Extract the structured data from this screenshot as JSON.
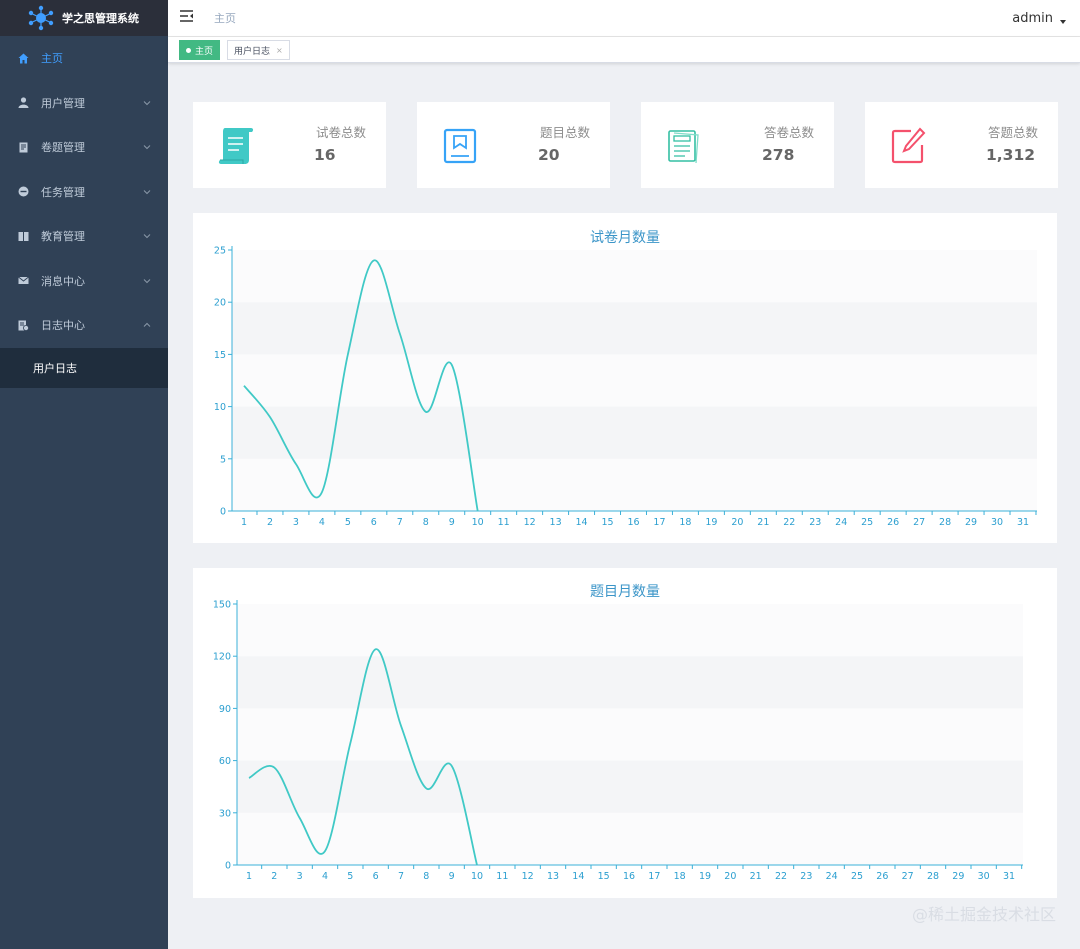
{
  "app": {
    "title": "学之思管理系统"
  },
  "sidebar": {
    "items": [
      {
        "label": "主页",
        "icon": "home-icon",
        "active": true
      },
      {
        "label": "用户管理",
        "icon": "user-icon"
      },
      {
        "label": "卷题管理",
        "icon": "paper-icon"
      },
      {
        "label": "任务管理",
        "icon": "task-icon"
      },
      {
        "label": "教育管理",
        "icon": "book-icon"
      },
      {
        "label": "消息中心",
        "icon": "mail-icon"
      },
      {
        "label": "日志中心",
        "icon": "log-icon",
        "expanded": true
      }
    ],
    "submenu": [
      {
        "label": "用户日志"
      }
    ]
  },
  "header": {
    "breadcrumb": "主页",
    "user": "admin"
  },
  "tags": [
    {
      "label": "主页",
      "active": true
    },
    {
      "label": "用户日志",
      "active": false
    }
  ],
  "cards": [
    {
      "label": "试卷总数",
      "value": "16",
      "icon": "scroll-icon",
      "color": "#40c9c6"
    },
    {
      "label": "题目总数",
      "value": "20",
      "icon": "question-icon",
      "color": "#36a3f7"
    },
    {
      "label": "答卷总数",
      "value": "278",
      "icon": "answer-sheet-icon",
      "color": "#34bfa3"
    },
    {
      "label": "答题总数",
      "value": "1,312",
      "icon": "edit-icon",
      "color": "#f4516c"
    }
  ],
  "chart_data": [
    {
      "type": "line",
      "title": "试卷月数量",
      "x": [
        "1",
        "2",
        "3",
        "4",
        "5",
        "6",
        "7",
        "8",
        "9",
        "10",
        "11",
        "12",
        "13",
        "14",
        "15",
        "16",
        "17",
        "18",
        "19",
        "20",
        "21",
        "22",
        "23",
        "24",
        "25",
        "26",
        "27",
        "28",
        "29",
        "30",
        "31"
      ],
      "values": [
        12,
        9,
        4.5,
        1.8,
        15,
        24,
        17,
        9.5,
        14,
        0,
        null,
        null,
        null,
        null,
        null,
        null,
        null,
        null,
        null,
        null,
        null,
        null,
        null,
        null,
        null,
        null,
        null,
        null,
        null,
        null,
        null
      ],
      "ylim": [
        0,
        25
      ],
      "yticks": [
        0,
        5,
        10,
        15,
        20,
        25
      ],
      "color": "#40c9c6"
    },
    {
      "type": "line",
      "title": "题目月数量",
      "x": [
        "1",
        "2",
        "3",
        "4",
        "5",
        "6",
        "7",
        "8",
        "9",
        "10",
        "11",
        "12",
        "13",
        "14",
        "15",
        "16",
        "17",
        "18",
        "19",
        "20",
        "21",
        "22",
        "23",
        "24",
        "25",
        "26",
        "27",
        "28",
        "29",
        "30",
        "31"
      ],
      "values": [
        50,
        56,
        27,
        8,
        70,
        124,
        80,
        44,
        57,
        0,
        null,
        null,
        null,
        null,
        null,
        null,
        null,
        null,
        null,
        null,
        null,
        null,
        null,
        null,
        null,
        null,
        null,
        null,
        null,
        null,
        null
      ],
      "ylim": [
        0,
        150
      ],
      "yticks": [
        0,
        30,
        60,
        90,
        120,
        150
      ],
      "color": "#40c9c6"
    }
  ],
  "watermark": "@稀土掘金技术社区"
}
